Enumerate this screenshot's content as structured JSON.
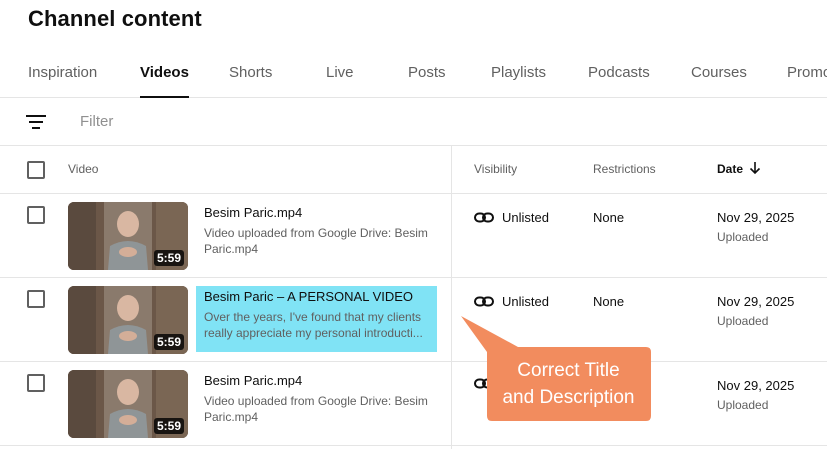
{
  "page_title": "Channel content",
  "tabs": [
    {
      "label": "Inspiration",
      "active": false
    },
    {
      "label": "Videos",
      "active": true
    },
    {
      "label": "Shorts",
      "active": false
    },
    {
      "label": "Live",
      "active": false
    },
    {
      "label": "Posts",
      "active": false
    },
    {
      "label": "Playlists",
      "active": false
    },
    {
      "label": "Podcasts",
      "active": false
    },
    {
      "label": "Courses",
      "active": false
    },
    {
      "label": "Promo",
      "active": false
    }
  ],
  "filter": {
    "placeholder": "Filter",
    "icon": "filter-lines-icon"
  },
  "table": {
    "headers": {
      "video": "Video",
      "visibility": "Visibility",
      "restrictions": "Restrictions",
      "date": "Date",
      "date_sort_icon": "arrow-down-icon"
    },
    "rows": [
      {
        "duration": "5:59",
        "title": "Besim Paric.mp4",
        "description": "Video uploaded from Google Drive: Besim Paric.mp4",
        "visibility": "Unlisted",
        "restrictions": "None",
        "date": "Nov 29, 2025",
        "date_status": "Uploaded",
        "highlighted": false
      },
      {
        "duration": "5:59",
        "title": "Besim Paric – A PERSONAL VIDEO",
        "description": "Over the years, I've found that my clients really appreciate my personal introducti...",
        "visibility": "Unlisted",
        "restrictions": "None",
        "date": "Nov 29, 2025",
        "date_status": "Uploaded",
        "highlighted": true
      },
      {
        "duration": "5:59",
        "title": "Besim Paric.mp4",
        "description": "Video uploaded from Google Drive: Besim Paric.mp4",
        "visibility": "",
        "restrictions": "",
        "date": "Nov 29, 2025",
        "date_status": "Uploaded",
        "highlighted": false
      }
    ]
  },
  "callout": {
    "line1": "Correct Title",
    "line2": "and Description",
    "color": "#f28c5e"
  },
  "colors": {
    "highlight": "#80e3f5",
    "active_tab": "#0f0f0f",
    "muted_text": "#606060"
  }
}
